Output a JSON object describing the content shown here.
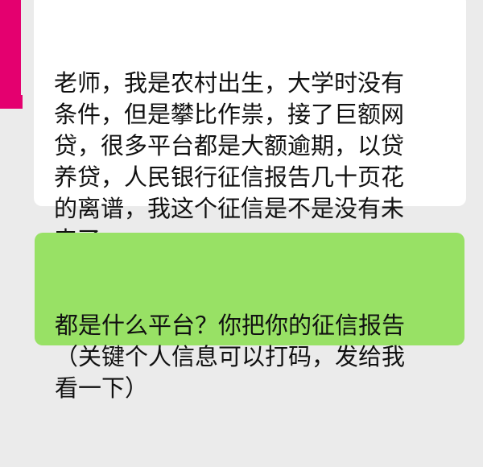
{
  "chat": {
    "incoming_message": "老师，我是农村出生，大学时没有\n条件，但是攀比作祟，接了巨额网\n贷，很多平台都是大额逾期，以贷\n养贷，人民银行征信报告几十页花\n的离谱，我这个征信是不是没有未\n来了",
    "outgoing_message": "都是什么平台？你把你的征信报告\n（关键个人信息可以打码，发给我\n看一下）"
  },
  "colors": {
    "background": "#ebebeb",
    "incoming_bubble": "#ffffff",
    "outgoing_bubble": "#98e165",
    "avatar_accent": "#e4006f"
  }
}
